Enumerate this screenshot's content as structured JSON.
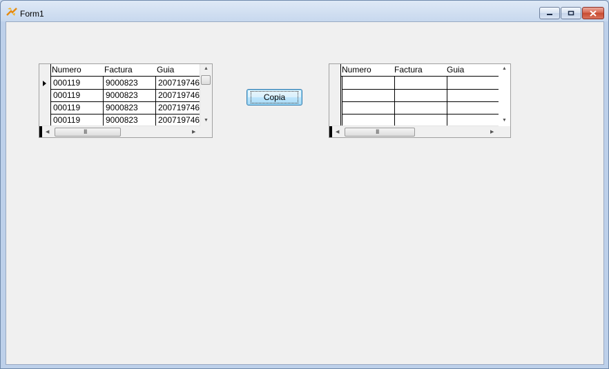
{
  "window": {
    "title": "Form1"
  },
  "copy_button": {
    "label": "Copia"
  },
  "grid_left": {
    "columns": [
      "Numero",
      "Factura",
      "Guia"
    ],
    "rows": [
      [
        "000119",
        "9000823",
        "200719746"
      ],
      [
        "000119",
        "9000823",
        "200719746"
      ],
      [
        "000119",
        "9000823",
        "200719746"
      ],
      [
        "000119",
        "9000823",
        "200719746"
      ]
    ]
  },
  "grid_right": {
    "columns": [
      "Numero",
      "Factura",
      "Guia"
    ],
    "rows": [
      [
        "",
        "",
        ""
      ],
      [
        "",
        "",
        ""
      ],
      [
        "",
        "",
        ""
      ],
      [
        "",
        "",
        ""
      ]
    ]
  },
  "scroll_glyphs": {
    "up": "▲",
    "down": "▼",
    "left": "◀",
    "right": "▶",
    "grip": "III"
  },
  "colors": {
    "title_bar": "#c7d8ee",
    "client_bg": "#f0f0f0",
    "button_accent": "#3c7fb1",
    "close_button": "#c74a30"
  }
}
